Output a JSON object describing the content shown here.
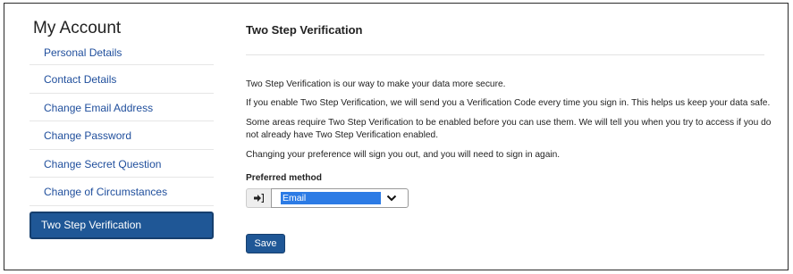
{
  "sidebar": {
    "title": "My Account",
    "items": [
      {
        "label": "Personal Details"
      },
      {
        "label": "Contact Details"
      },
      {
        "label": "Change Email Address"
      },
      {
        "label": "Change Password"
      },
      {
        "label": "Change Secret Question"
      },
      {
        "label": "Change of Circumstances"
      },
      {
        "label": "Two Step Verification",
        "active": true
      }
    ]
  },
  "main": {
    "title": "Two Step Verification",
    "paragraphs": [
      "Two Step Verification is our way to make your data more secure.",
      "If you enable Two Step Verification, we will send you a Verification Code every time you sign in. This helps us keep your data safe.",
      "Some areas require Two Step Verification to be enabled before you can use them. We will tell you when you try to access if you do not already have Two Step Verification enabled.",
      "Changing your preference will sign you out, and you will need to sign in again."
    ],
    "preferred_label": "Preferred method",
    "preferred_value": "Email",
    "save_label": "Save"
  },
  "colors": {
    "accent": "#1f5796",
    "link": "#1f4e9c",
    "selection": "#2c7be5"
  },
  "icons": {
    "addon": "sign-in-arrow-icon",
    "dropdown": "chevron-down-icon"
  }
}
